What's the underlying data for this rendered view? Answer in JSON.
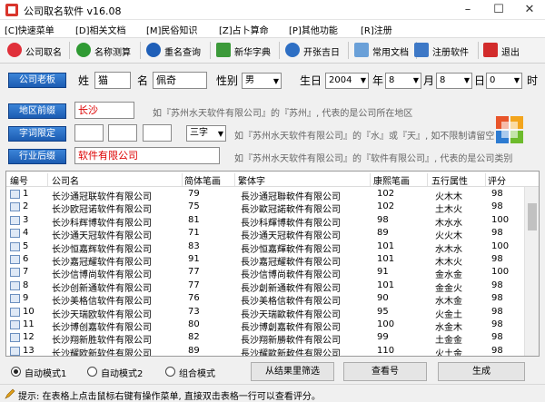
{
  "window": {
    "title": "公司取名软件 v16.08",
    "minimize": "–",
    "maximize": "☐",
    "close": "✕"
  },
  "menu": [
    "[C]快速菜单",
    "[D]相关文档",
    "[M]民俗知识",
    "[Z]占卜算命",
    "[P]其他功能",
    "[R]注册"
  ],
  "toolbar": [
    {
      "label": "公司取名",
      "icon": "heart-icon",
      "color": "#e0303a"
    },
    {
      "label": "名称测算",
      "icon": "arrow-right-icon",
      "color": "#2f9a33"
    },
    {
      "label": "重名查询",
      "icon": "info-icon",
      "color": "#1f5fb8"
    },
    {
      "label": "新华字典",
      "icon": "dictionary-icon",
      "color": "#3c9a3a"
    },
    {
      "label": "开张吉日",
      "icon": "calendar-icon",
      "color": "#2e6fc4"
    },
    {
      "label": "常用文档",
      "icon": "document-icon",
      "color": "#6aa0d8"
    },
    {
      "label": "注册软件",
      "icon": "register-icon",
      "color": "#3d78c6"
    },
    {
      "label": "退出",
      "icon": "exit-icon",
      "color": "#d22b2b"
    }
  ],
  "form": {
    "company_btn": "公司老板",
    "surname_label": "姓",
    "surname_value": "猫",
    "given_label": "名",
    "given_value": "佩奇",
    "gender_label": "性别",
    "gender_value": "男",
    "birthday_label": "生日",
    "year": "2004",
    "year_unit": "年",
    "month": "8",
    "month_unit": "月",
    "day": "8",
    "day_unit": "日",
    "hour": "0",
    "hour_unit": "时",
    "region_btn": "地区前缀",
    "region_value": "长沙",
    "region_hint": "如『苏州水天软件有限公司』的『苏州』, 代表的是公司所在地区",
    "char_btn": "字词限定",
    "char_count": "三字",
    "char_hint": "如『苏州水天软件有限公司』的『水』或『天』, 如不限制请留空",
    "industry_btn": "行业后缀",
    "industry_value": "软件有限公司",
    "industry_hint": "如『苏州水天软件有限公司』的『软件有限公司』, 代表的是公司类别"
  },
  "table": {
    "headers": [
      "编号",
      "公司名",
      "简体笔画",
      "繁体字",
      "康熙笔画",
      "五行属性",
      "评分"
    ],
    "rows": [
      [
        "1",
        "长沙通冠联软件有限公司",
        "79",
        "長沙通冠聯軟件有限公司",
        "102",
        "火木木",
        "98"
      ],
      [
        "2",
        "长沙欧冠诺软件有限公司",
        "75",
        "長沙歐冠諾軟件有限公司",
        "102",
        "土木火",
        "98"
      ],
      [
        "3",
        "长沙科辉博软件有限公司",
        "81",
        "長沙科輝博軟件有限公司",
        "98",
        "木水水",
        "100"
      ],
      [
        "4",
        "长沙通天冠软件有限公司",
        "71",
        "長沙通天冠軟件有限公司",
        "89",
        "火火木",
        "98"
      ],
      [
        "5",
        "长沙恒嘉辉软件有限公司",
        "83",
        "長沙恒嘉輝軟件有限公司",
        "101",
        "水木水",
        "100"
      ],
      [
        "6",
        "长沙嘉冠耀软件有限公司",
        "91",
        "長沙嘉冠耀軟件有限公司",
        "101",
        "木木火",
        "98"
      ],
      [
        "7",
        "长沙信博尚软件有限公司",
        "77",
        "長沙信博尚軟件有限公司",
        "91",
        "金水金",
        "100"
      ],
      [
        "8",
        "长沙创新通软件有限公司",
        "77",
        "長沙創新通軟件有限公司",
        "101",
        "金金火",
        "98"
      ],
      [
        "9",
        "长沙美格信软件有限公司",
        "76",
        "長沙美格信軟件有限公司",
        "90",
        "水木金",
        "98"
      ],
      [
        "10",
        "长沙天瑞欧软件有限公司",
        "73",
        "長沙天瑞歐軟件有限公司",
        "95",
        "火金土",
        "98"
      ],
      [
        "11",
        "长沙博创嘉软件有限公司",
        "80",
        "長沙博創嘉軟件有限公司",
        "100",
        "水金木",
        "98"
      ],
      [
        "12",
        "长沙翔新胜软件有限公司",
        "82",
        "長沙翔新勝軟件有限公司",
        "99",
        "土金金",
        "98"
      ],
      [
        "13",
        "长沙耀欧新软件有限公司",
        "89",
        "長沙耀歐新軟件有限公司",
        "110",
        "火土金",
        "98"
      ]
    ]
  },
  "bottom": {
    "mode1": "自动模式1",
    "mode2": "自动模式2",
    "mode3": "组合模式",
    "filter_btn": "从结果里筛选",
    "view_btn": "查看号",
    "generate_btn": "生成"
  },
  "status": {
    "tip": "提示: 在表格上点击鼠标右键有操作菜单, 直接双击表格一行可以查看评分。"
  }
}
